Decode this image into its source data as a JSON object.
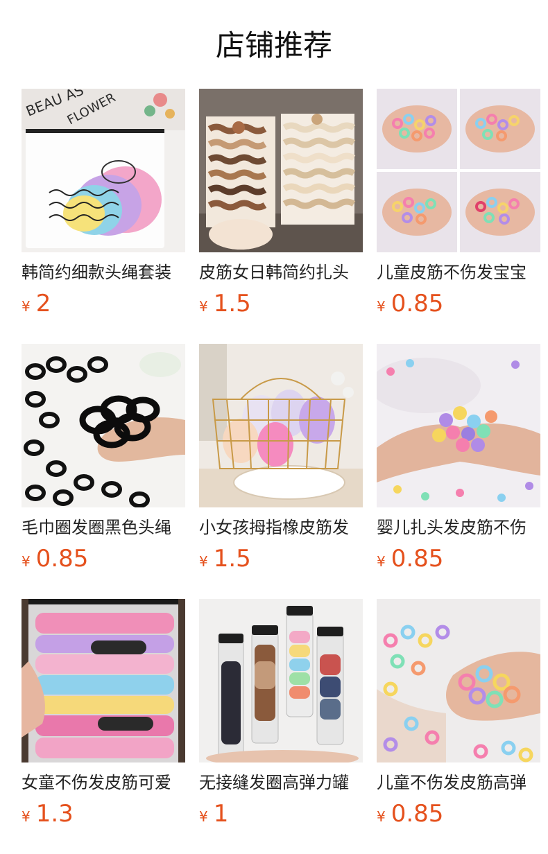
{
  "page": {
    "title": "店铺推荐"
  },
  "currency_symbol": "¥",
  "colors": {
    "price": "#e5511d",
    "text": "#222222",
    "background": "#ffffff"
  },
  "products": [
    {
      "name": "韩简约细款头绳套装",
      "price": "2",
      "image": "bag-of-pastel-hair-ties-flower-print"
    },
    {
      "name": "皮筋女日韩简约扎头",
      "price": "1.5",
      "image": "brown-and-cream-hair-tie-cards"
    },
    {
      "name": "儿童皮筋不伤发宝宝",
      "price": "0.85",
      "image": "hands-holding-colorful-mini-hair-ties-collage"
    },
    {
      "name": "毛巾圈发圈黑色头绳",
      "price": "0.85",
      "image": "hand-holding-black-hair-ties"
    },
    {
      "name": "小女孩拇指橡皮筋发",
      "price": "1.5",
      "image": "gold-wire-basket-with-hair-tie-bags"
    },
    {
      "name": "婴儿扎头发皮筋不伤",
      "price": "0.85",
      "image": "hands-holding-pastel-fluffy-hair-ties"
    },
    {
      "name": "女童不伤发皮筋可爱",
      "price": "1.3",
      "image": "packaged-pink-and-rainbow-hair-ties"
    },
    {
      "name": "无接缝发圈高弹力罐",
      "price": "1",
      "image": "clear-tubes-of-hair-ties"
    },
    {
      "name": "儿童不伤发皮筋高弹",
      "price": "0.85",
      "image": "hands-holding-mixed-pastel-hair-ties"
    }
  ]
}
